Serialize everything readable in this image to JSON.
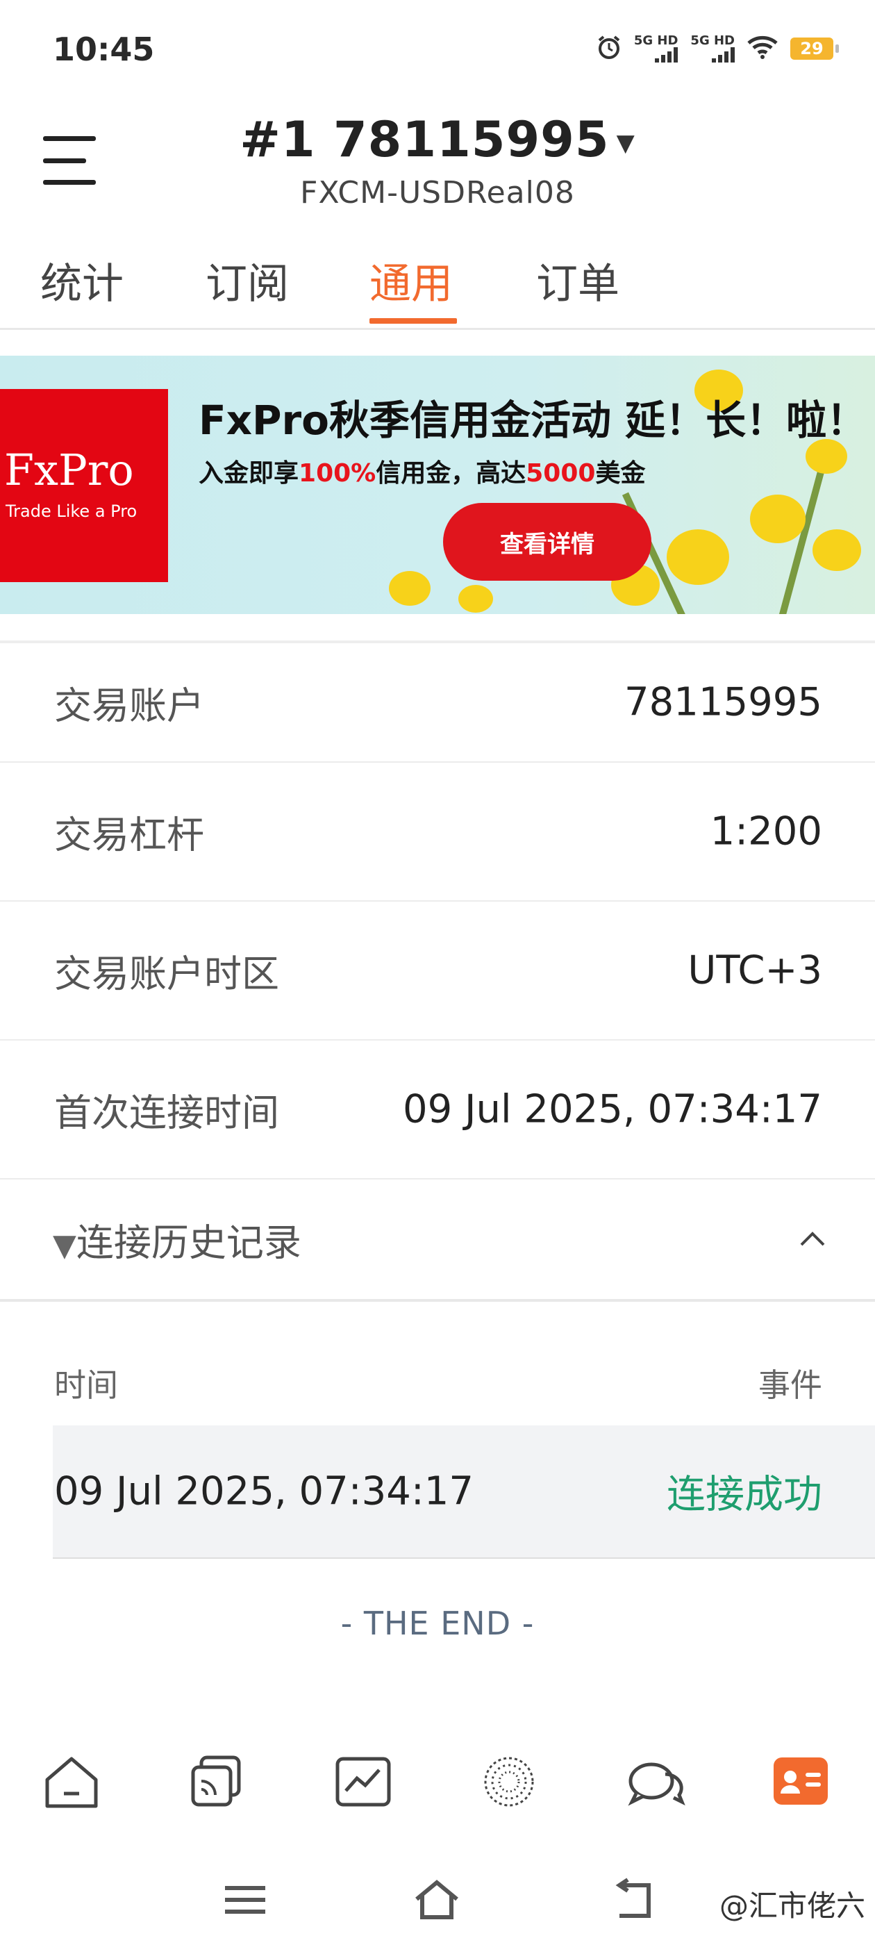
{
  "status_bar": {
    "time": "10:45",
    "signal_1": "5G HD",
    "signal_2": "5G HD",
    "battery": "29",
    "icons": [
      "alarm-icon",
      "signal-icon",
      "signal-icon",
      "wifi-icon",
      "battery-icon"
    ]
  },
  "header": {
    "account_title": "#1 78115995",
    "server": "FXCM-USDReal08"
  },
  "tabs": [
    {
      "label": "统计",
      "active": false
    },
    {
      "label": "订阅",
      "active": false
    },
    {
      "label": "通用",
      "active": true
    },
    {
      "label": "订单",
      "active": false
    }
  ],
  "banner": {
    "brand": "FxPro",
    "brand_tagline": "Trade Like a Pro",
    "title": "FxPro秋季信用金活动 延！长！啦！",
    "subtitle_part1": "入金即享",
    "subtitle_hl1": "100%",
    "subtitle_part2": "信用金，高达",
    "subtitle_hl2": "5000",
    "subtitle_part3": "美金",
    "cta": "查看详情"
  },
  "info_rows": [
    {
      "label": "交易账户",
      "value": "78115995"
    },
    {
      "label": "交易杠杆",
      "value": "1:200"
    },
    {
      "label": "交易账户时区",
      "value": "UTC+3"
    },
    {
      "label": "首次连接时间",
      "value": "09 Jul 2025, 07:34:17"
    }
  ],
  "history": {
    "label": "连接历史记录",
    "col_time": "时间",
    "col_event": "事件",
    "rows": [
      {
        "time": "09 Jul 2025, 07:34:17",
        "event": "连接成功"
      }
    ],
    "end_text": "- THE END -"
  },
  "bottom_nav": [
    "home-icon",
    "copy-icon",
    "chart-icon",
    "community-icon",
    "chat-icon",
    "profile-icon"
  ],
  "colors": {
    "accent": "#f26a2e",
    "success": "#1e9e6e",
    "brand_red": "#e30613"
  },
  "watermark": "@汇市佬六"
}
